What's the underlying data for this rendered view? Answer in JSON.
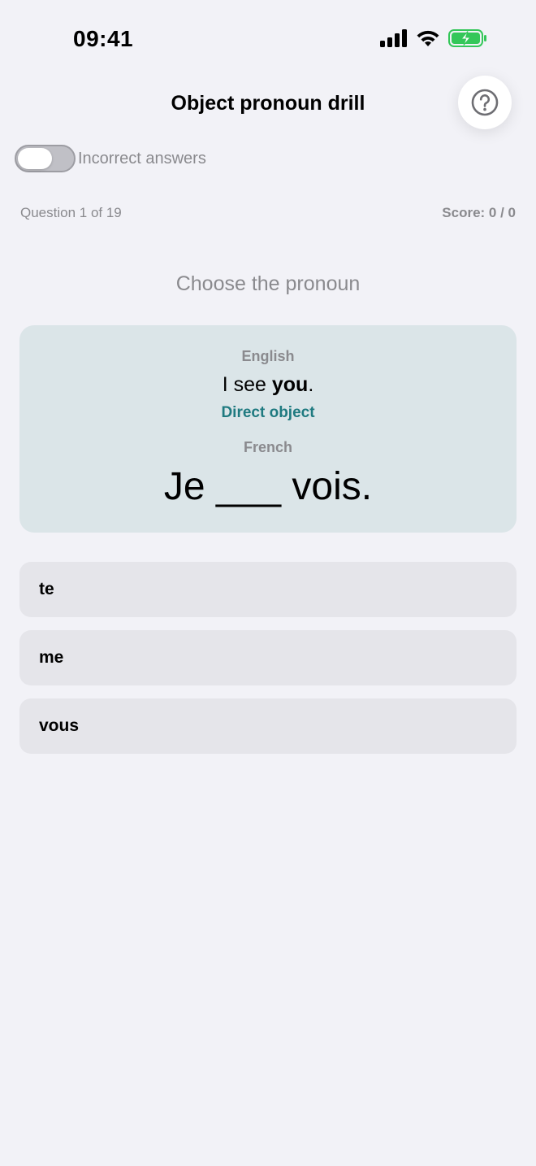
{
  "status_bar": {
    "time": "09:41"
  },
  "nav": {
    "title": "Object pronoun drill",
    "help_icon": "question-circle-icon"
  },
  "settings": {
    "toggle_label": "Incorrect answers",
    "toggle_on": false
  },
  "progress": {
    "question_counter": "Question 1 of 19",
    "score": "Score: 0 / 0"
  },
  "prompt": "Choose the pronoun",
  "card": {
    "english_label": "English",
    "english_before": "I see ",
    "english_highlight": "you",
    "english_after": ".",
    "object_type": "Direct object",
    "french_label": "French",
    "french_sentence": "Je ___ vois."
  },
  "options": [
    {
      "label": "te"
    },
    {
      "label": "me"
    },
    {
      "label": "vous"
    }
  ],
  "colors": {
    "background": "#f2f2f7",
    "card": "#dbe5e8",
    "accent": "#1f7a80",
    "option": "#e5e5ea",
    "battery": "#34c759"
  }
}
